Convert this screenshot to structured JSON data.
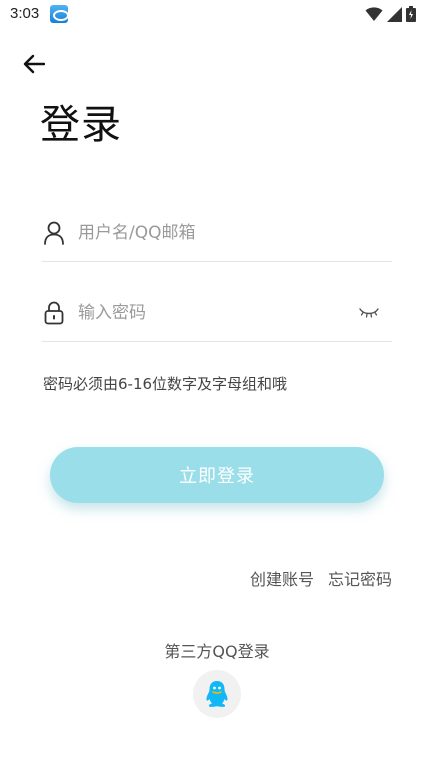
{
  "status_bar": {
    "time": "3:03",
    "app_icon": "app-notification-icon",
    "icons": [
      "wifi-icon",
      "signal-icon",
      "battery-icon"
    ]
  },
  "header": {
    "back_icon": "arrow-left-icon",
    "title": "登录"
  },
  "form": {
    "username": {
      "icon": "user-icon",
      "placeholder": "用户名/QQ邮箱",
      "value": ""
    },
    "password": {
      "icon": "lock-icon",
      "placeholder": "输入密码",
      "value": "",
      "toggle_icon": "eye-closed-icon"
    },
    "hint": "密码必须由6-16位数字及字母组和哦",
    "submit_label": "立即登录"
  },
  "links": {
    "register": "创建账号",
    "forgot": "忘记密码"
  },
  "third_party": {
    "label": "第三方QQ登录",
    "qq_icon": "qq-penguin-icon"
  },
  "colors": {
    "accent": "#9adee9",
    "qq_blue": "#12b7f5",
    "divider": "#e4e4e4"
  }
}
